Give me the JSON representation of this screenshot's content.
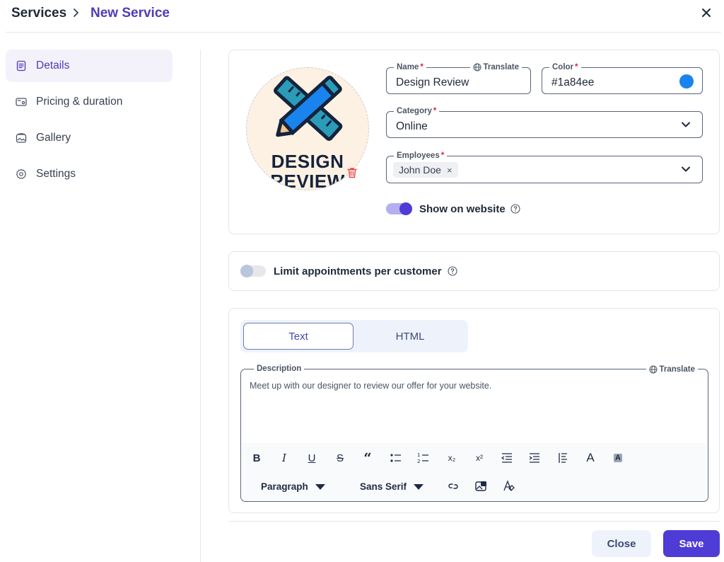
{
  "header": {
    "breadcrumb_root": "Services",
    "breadcrumb_current": "New Service"
  },
  "sidebar": {
    "items": [
      {
        "label": "Details",
        "icon": "document-icon",
        "active": true
      },
      {
        "label": "Pricing & duration",
        "icon": "wallet-icon",
        "active": false
      },
      {
        "label": "Gallery",
        "icon": "gallery-icon",
        "active": false
      },
      {
        "label": "Settings",
        "icon": "gear-icon",
        "active": false
      }
    ]
  },
  "details": {
    "avatar_text_line1": "DESIGN",
    "avatar_text_line2": "REVIEW",
    "name_label": "Name",
    "name_value": "Design Review",
    "translate_label": "Translate",
    "color_label": "Color",
    "color_value": "#1a84ee",
    "category_label": "Category",
    "category_value": "Online",
    "employees_label": "Employees",
    "employees": [
      "John Doe"
    ],
    "show_on_website_label": "Show on website",
    "show_on_website": true,
    "required_marker": "*"
  },
  "limits": {
    "label": "Limit appointments per customer",
    "enabled": false
  },
  "description": {
    "tabs": [
      "Text",
      "HTML"
    ],
    "active_tab": "Text",
    "label": "Description",
    "translate_label": "Translate",
    "text": "Meet up with our designer to review our offer for your website.",
    "paragraph_select": "Paragraph",
    "font_select": "Sans Serif"
  },
  "footer": {
    "close_label": "Close",
    "save_label": "Save"
  },
  "colors": {
    "accent": "#4f3bd6",
    "brand_text": "#4f3bb8",
    "service_color": "#1a84ee"
  }
}
